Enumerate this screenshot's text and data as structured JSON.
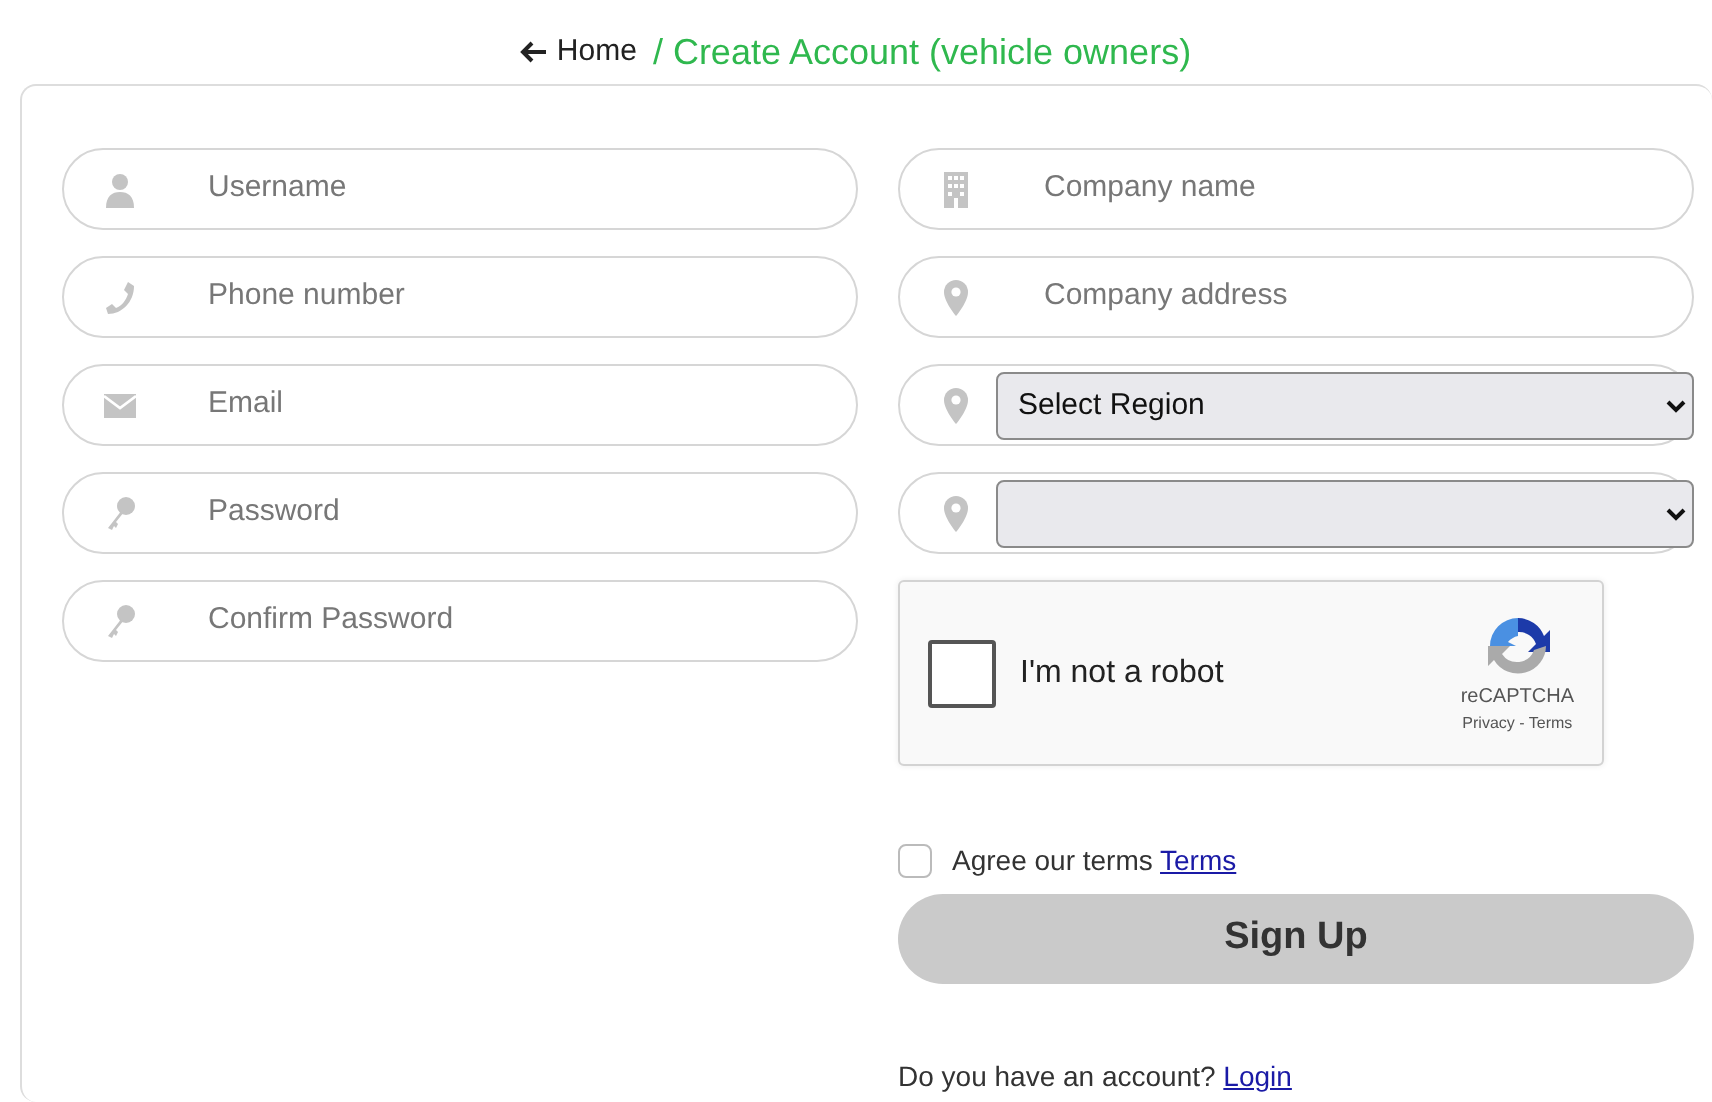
{
  "header": {
    "home_link": "Home",
    "title": "/ Create Account (vehicle owners)"
  },
  "left_fields": [
    {
      "placeholder": "Username"
    },
    {
      "placeholder": "Phone number"
    },
    {
      "placeholder": "Email"
    },
    {
      "placeholder": "Password"
    },
    {
      "placeholder": "Confirm Password"
    }
  ],
  "right_fields": [
    {
      "kind": "input",
      "placeholder": "Company name"
    },
    {
      "kind": "input",
      "placeholder": "Company address"
    },
    {
      "kind": "select",
      "value": "Select Region"
    },
    {
      "kind": "select"
    }
  ],
  "recaptcha": {
    "checked": false,
    "label": "I'm not a robot",
    "brand": "reCAPTCHA",
    "links": "Privacy - Terms"
  },
  "terms": {
    "checked": false,
    "label": "Agree our terms",
    "link": "Terms"
  },
  "sign_up_button": "Sign Up",
  "login_prompt": {
    "text": "Do you have an account?",
    "link": "Login"
  }
}
